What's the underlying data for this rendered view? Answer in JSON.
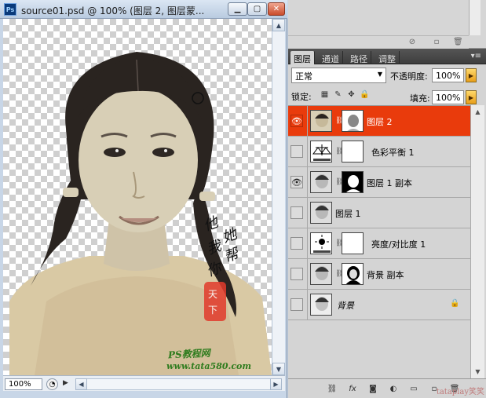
{
  "document": {
    "title": "source01.psd @ 100% (图层 2, 图层蒙...",
    "app_icon": "Ps",
    "zoom": "100%",
    "watermark_site": "PS教程网",
    "watermark_url": "www.tata580.com",
    "stamp_text": [
      "他",
      "她",
      "我",
      "帮",
      "你"
    ]
  },
  "layers_panel": {
    "tabs": [
      "图层",
      "通道",
      "路径",
      "调整"
    ],
    "blend_mode": "正常",
    "opacity_label": "不透明度:",
    "opacity_value": "100%",
    "lock_label": "锁定:",
    "fill_label": "填充:",
    "fill_value": "100%",
    "layers": [
      {
        "name": "图层 2",
        "visible": true,
        "selected": true,
        "type": "pixel-mask"
      },
      {
        "name": "色彩平衡 1",
        "visible": false,
        "selected": false,
        "type": "adjust-balance"
      },
      {
        "name": "图层 1 副本",
        "visible": true,
        "selected": false,
        "type": "pixel-mask"
      },
      {
        "name": "图层 1",
        "visible": false,
        "selected": false,
        "type": "pixel"
      },
      {
        "name": "亮度/对比度 1",
        "visible": false,
        "selected": false,
        "type": "adjust-brightness"
      },
      {
        "name": "背景 副本",
        "visible": false,
        "selected": false,
        "type": "pixel-mask-dark"
      },
      {
        "name": "背景",
        "visible": false,
        "selected": false,
        "type": "background",
        "locked": true
      }
    ]
  },
  "icons": {
    "eye": "eye-icon",
    "chain": "link-icon",
    "lock": "lock-icon"
  },
  "colors": {
    "selected_layer": "#e93b0c",
    "tabs_bg": "#444444",
    "panel_bg": "#d4d4d4"
  },
  "corner_watermark": "tataplay笑笑"
}
